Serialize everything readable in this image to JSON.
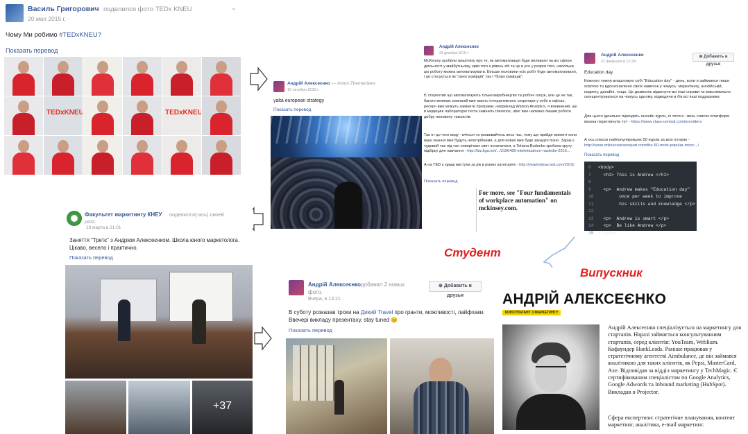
{
  "post1": {
    "author": "Василь Григорович",
    "action": "поделился фото TEDx KNEU",
    "date": "20 мая 2015 г. ·",
    "text": "Чому Ми робимо ",
    "hashtag": "#TEDxKNEU?",
    "translate": "Показать перевод",
    "tiles": [
      "TEDxKNEU",
      "TEDxKNEU"
    ]
  },
  "post2": {
    "author": "Андрій Алексеєнко",
    "action": "— Anton Zhemerdeev",
    "date": "10 октября 2015 г. ·",
    "text": "yalta european strategy",
    "translate": "Показать перевод"
  },
  "post3": {
    "author": "Андрій Алексеєнко",
    "date": "29 декабря 2015 г. ·",
    "p1": "McKinsey зробили аналітику про те, як автоматизація буде впливати на всі сфери діяльності у майбутньому, крім того є рівень sth та це в усе у розрізі того, наскільки цю роботу можна автоматизувати. Більше половини усіх робіт буде автоматизовано, і це стосується як \"синіх комірців\" так і \"білих комірців\".",
    "p2": "Є стереотип що автоматизують тільки виробництво та робочі галузі, але це не так, багато великих компаній вже мають інтерактивного секретаря у себе в офісах, ресерч вже можуть замінити програми, наприклад Watson Analytics, я впевнений, що в медицині лабораторні тести замінить theranos, uber вже напевно лишив роботи добру половину таксистів.",
    "p3": "Так от до чого веду - вчіться та розвивайтесь весь час, тому що прийде момент коли ваші знання вже будуть непотрібними, а для нових вже буде занадто пізно. Зараз є чудовий час під час новорічних свят поличитися, а Tetiana Budenko зробила круту підбірку для навчання -",
    "p3link": "http://biz.liga.net/.../3196485-intelektualnoe-nasledie-2015...",
    "p4": "А на TED є краші виступи за рік в різних категоріях -",
    "p4link": "http://yearinideas.ted.com/2015/",
    "translate": "Показать перевод",
    "box_text": "For more, see \"Four fundamentals of workplace automation\" on mckinsey.com."
  },
  "post4": {
    "author": "Андрій Алексеєнко",
    "date": "21 февраля в 12:34 ·",
    "add_friend": "Добавить в друзья",
    "title": "Education day",
    "p1": "Кожного тижня влаштовую собі \"Education day\" - день, коли я займаюся лише освітою та вдосконаленні своїх навичок у чомусь: маркетингу, англійській, кодингу, дизайні, тощо. Це дозволяє відкинути всі інші справи та максимально сконцентруватися на чомусь одному, відводячи в бік всі інші подразники.",
    "p2": "Для цього ідеально підходять онлайн курси, їх тисячі - весь список платформ можна переглянути тут -",
    "p2link": "https://www.class-central.com/providers",
    "p3": "А ось список найпопулярніших 50 курсів за всю історію -",
    "p3link": "http://www.onlinecoursereport.com/the-50-most-popular-mooc.../",
    "translate": "Показать перевод",
    "code": [
      {
        "n": "6",
        "t": "<body>"
      },
      {
        "n": "7",
        "t": "  <h1> This is Andrew </h1>"
      },
      {
        "n": "8",
        "t": ""
      },
      {
        "n": "9",
        "t": "  <p>  Andrew makes \"Education day\""
      },
      {
        "n": "10",
        "t": "        once per week to improve"
      },
      {
        "n": "11",
        "t": "        his skills and knowledge </p>"
      },
      {
        "n": "12",
        "t": ""
      },
      {
        "n": "13",
        "t": "  <p>  Andrew is smart </p>"
      },
      {
        "n": "14",
        "t": "  <p>  Be like Andrew </p>"
      },
      {
        "n": "15",
        "t": "</body>"
      }
    ]
  },
  "post5": {
    "author": "Факультет маркетингу КНЕУ",
    "action": "поделился(-ась) своей",
    "action2": "post.",
    "date": "18 марта в 21:01 ·",
    "text": "Заняття \"Третє\" з Андрієм Алексеєнком. Школа юного маркетолога. Цікаво, весело і практично.",
    "translate": "Показать перевод",
    "more": "+37"
  },
  "post6": {
    "author": "Андрій Алексеєнко",
    "action": "добавил 2 новых",
    "action2": "фото.",
    "date": "Вчера, в 13:21 ·",
    "add_friend": "Добавить в друзья",
    "text1": "В суботу розказав трохи на ",
    "textlink": "Дикий Travel",
    "text2": " про гранти, можливості, лайфхаки. Ввечері викладу презентаху, stay tuned 😊",
    "translate": "Показать перевод"
  },
  "labels": {
    "student": "Студент",
    "graduate": "Випускник"
  },
  "profile": {
    "name": "АНДРІЙ АЛЕКСЕЄНКО",
    "tag": "консультант з маркетингу",
    "bio": "Андрій Алексеєнко спеціалізується на маркетингу для стартапів. Наразі займається консультуванням стартапів, серед клієнтів: YouTeam, Weblium. Кофаундер HankLeads. Раніше працював у стратегічному агентстві Aimbulance, де він займався аналітикою для таких клієнтів, як Pepsi, MasterCard, Axe. Відповідав за відділ маркетингу у TechMagic. Є сертифікованим спеціалістом по Google Analytics, Google Adwords та Inbound marketing (HubSpot). Викладав в Projector.",
    "expertise": "Сфера експертизи: стратегічне планування, контент маркетинг, аналітика, e-mail маркетинг."
  },
  "colors": {
    "link": "#365899",
    "accent_red": "#e02020",
    "highlight_yellow": "#f2d500",
    "code_bg": "#2b3036"
  }
}
